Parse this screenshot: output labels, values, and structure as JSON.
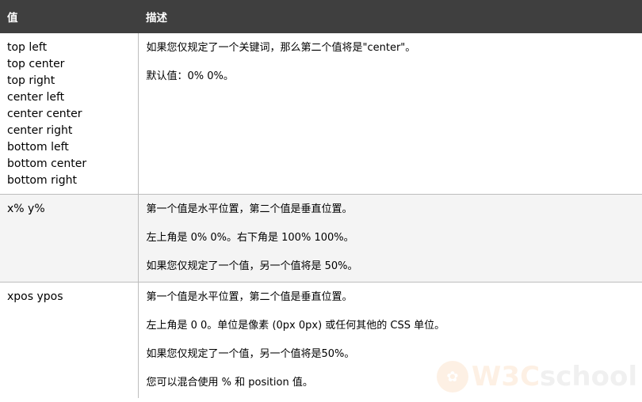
{
  "table": {
    "headers": [
      "值",
      "描述"
    ],
    "rows": [
      {
        "values": [
          "top left",
          "top center",
          "top right",
          "center left",
          "center center",
          "center right",
          "bottom left",
          "bottom center",
          "bottom right"
        ],
        "description": [
          "如果您仅规定了一个关键词，那么第二个值将是\"center\"。",
          "默认值：0% 0%。"
        ]
      },
      {
        "values": [
          "x% y%"
        ],
        "description": [
          "第一个值是水平位置，第二个值是垂直位置。",
          "左上角是 0% 0%。右下角是 100% 100%。",
          "如果您仅规定了一个值，另一个值将是 50%。"
        ]
      },
      {
        "values": [
          "xpos ypos"
        ],
        "description": [
          "第一个值是水平位置，第二个值是垂直位置。",
          "左上角是 0 0。单位是像素 (0px 0px) 或任何其他的 CSS 单位。",
          "如果您仅规定了一个值，另一个值将是50%。",
          "您可以混合使用 % 和 position 值。"
        ]
      }
    ]
  },
  "watermark": {
    "brand_a": "W3C",
    "brand_b": "school",
    "accent": "#f08a2a"
  }
}
